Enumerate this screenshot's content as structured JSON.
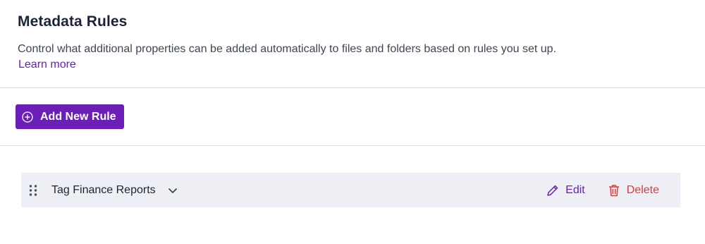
{
  "header": {
    "title": "Metadata Rules",
    "description": "Control what additional properties can be added automatically to files and folders based on rules you set up.",
    "learn_more": "Learn more"
  },
  "toolbar": {
    "add_rule_label": "Add New Rule",
    "add_rule_icon": "plus-circle-icon"
  },
  "rules": [
    {
      "name": "Tag Finance Reports",
      "edit_label": "Edit",
      "delete_label": "Delete",
      "icons": {
        "drag": "drag-handle-icon",
        "expand": "chevron-down-icon",
        "edit": "pencil-icon",
        "delete": "trash-icon"
      }
    }
  ],
  "colors": {
    "accent": "#6b1fb8",
    "danger": "#e2393b",
    "row_bg": "#edeff4",
    "divider": "#dcdde3"
  }
}
